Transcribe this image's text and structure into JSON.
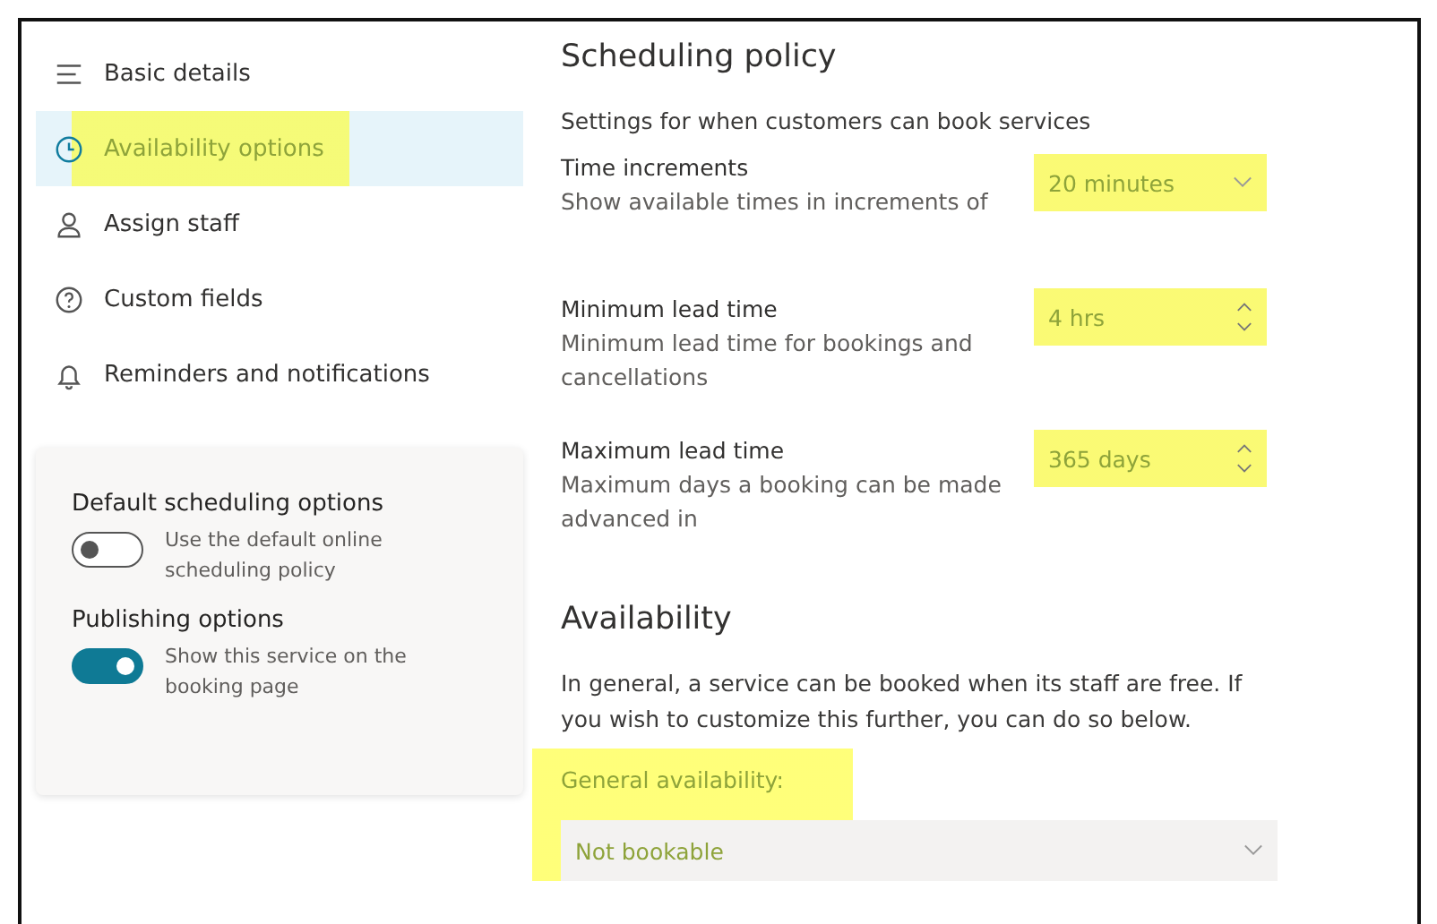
{
  "sidebar": {
    "items": [
      {
        "label": "Basic details",
        "kind": "menu",
        "selected": false,
        "highlighted": false
      },
      {
        "label": "Availability options",
        "kind": "clock",
        "selected": true,
        "highlighted": true
      },
      {
        "label": "Assign staff",
        "kind": "person",
        "selected": false,
        "highlighted": false
      },
      {
        "label": "Custom fields",
        "kind": "question",
        "selected": false,
        "highlighted": false
      },
      {
        "label": "Reminders and notifications",
        "kind": "bell",
        "selected": false,
        "highlighted": false
      }
    ],
    "card": {
      "sections": [
        {
          "title": "Default scheduling options",
          "toggle": {
            "label": "Use the default online scheduling policy",
            "on": false
          }
        },
        {
          "title": "Publishing options",
          "toggle": {
            "label": "Show this service on the booking page",
            "on": true
          }
        }
      ]
    }
  },
  "scheduling_policy": {
    "title": "Scheduling policy",
    "subtitle": "Settings for when customers can book services",
    "settings": [
      {
        "label": "Time increments",
        "description": "Show available times in increments of",
        "kind": "dropdown",
        "value": "20 minutes",
        "highlighted": true
      },
      {
        "label": "Minimum lead time",
        "description": "Minimum lead time for bookings and cancellations",
        "kind": "spinner",
        "value": "4 hrs",
        "highlighted": true
      },
      {
        "label": "Maximum lead time",
        "description": "Maximum days a booking can be made advanced in",
        "kind": "spinner",
        "value": "365 days",
        "highlighted": true
      }
    ]
  },
  "availability": {
    "title": "Availability",
    "description": "In general, a service can be booked when its staff are free. If you wish to customize this further, you can do so below.",
    "general": {
      "label": "General availability:",
      "value": "Not bookable",
      "highlighted": true
    }
  }
}
